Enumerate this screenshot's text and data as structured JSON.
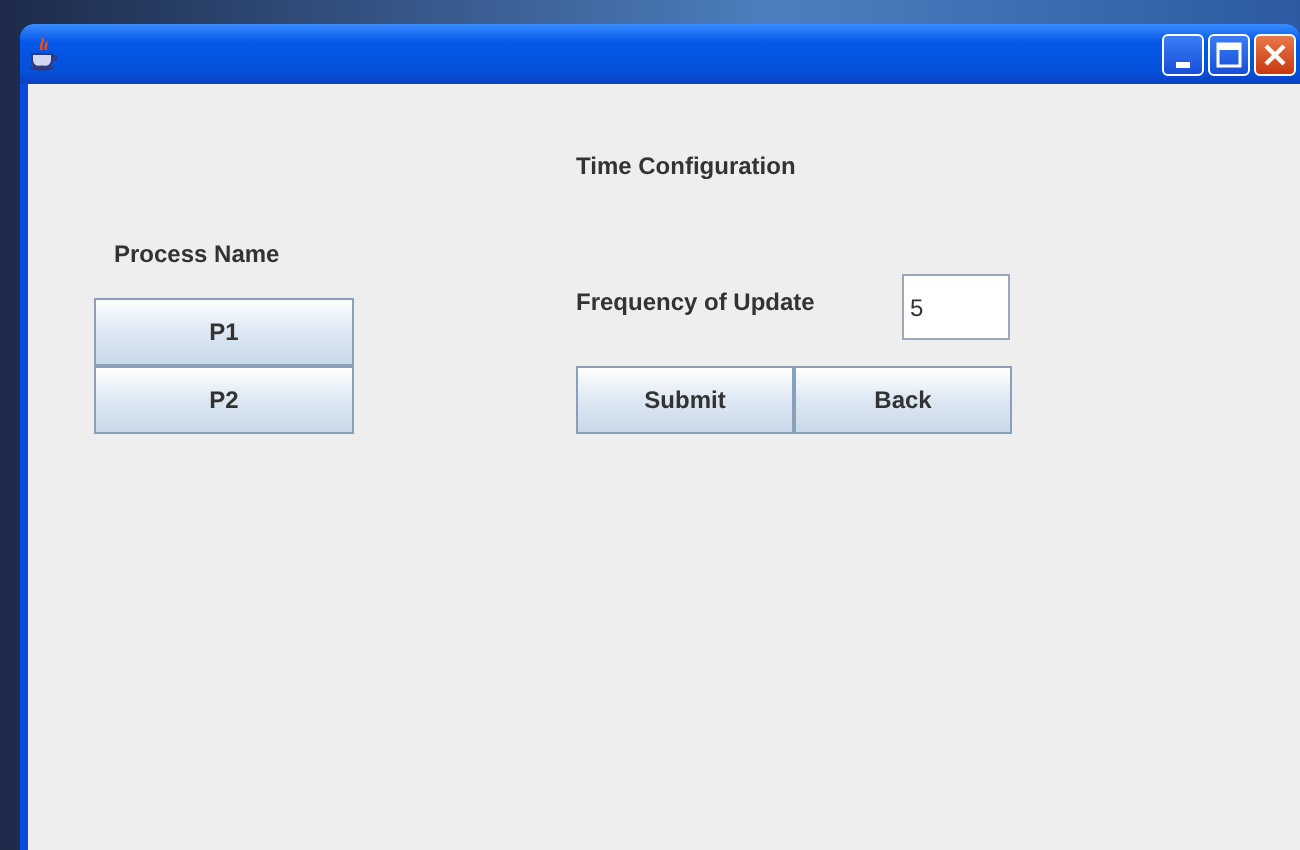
{
  "heading": "Time Configuration",
  "process_label": "Process Name",
  "processes": [
    {
      "label": "P1"
    },
    {
      "label": "P2"
    }
  ],
  "frequency": {
    "label": "Frequency of Update",
    "value": "5"
  },
  "buttons": [
    "Submit",
    "Back"
  ]
}
